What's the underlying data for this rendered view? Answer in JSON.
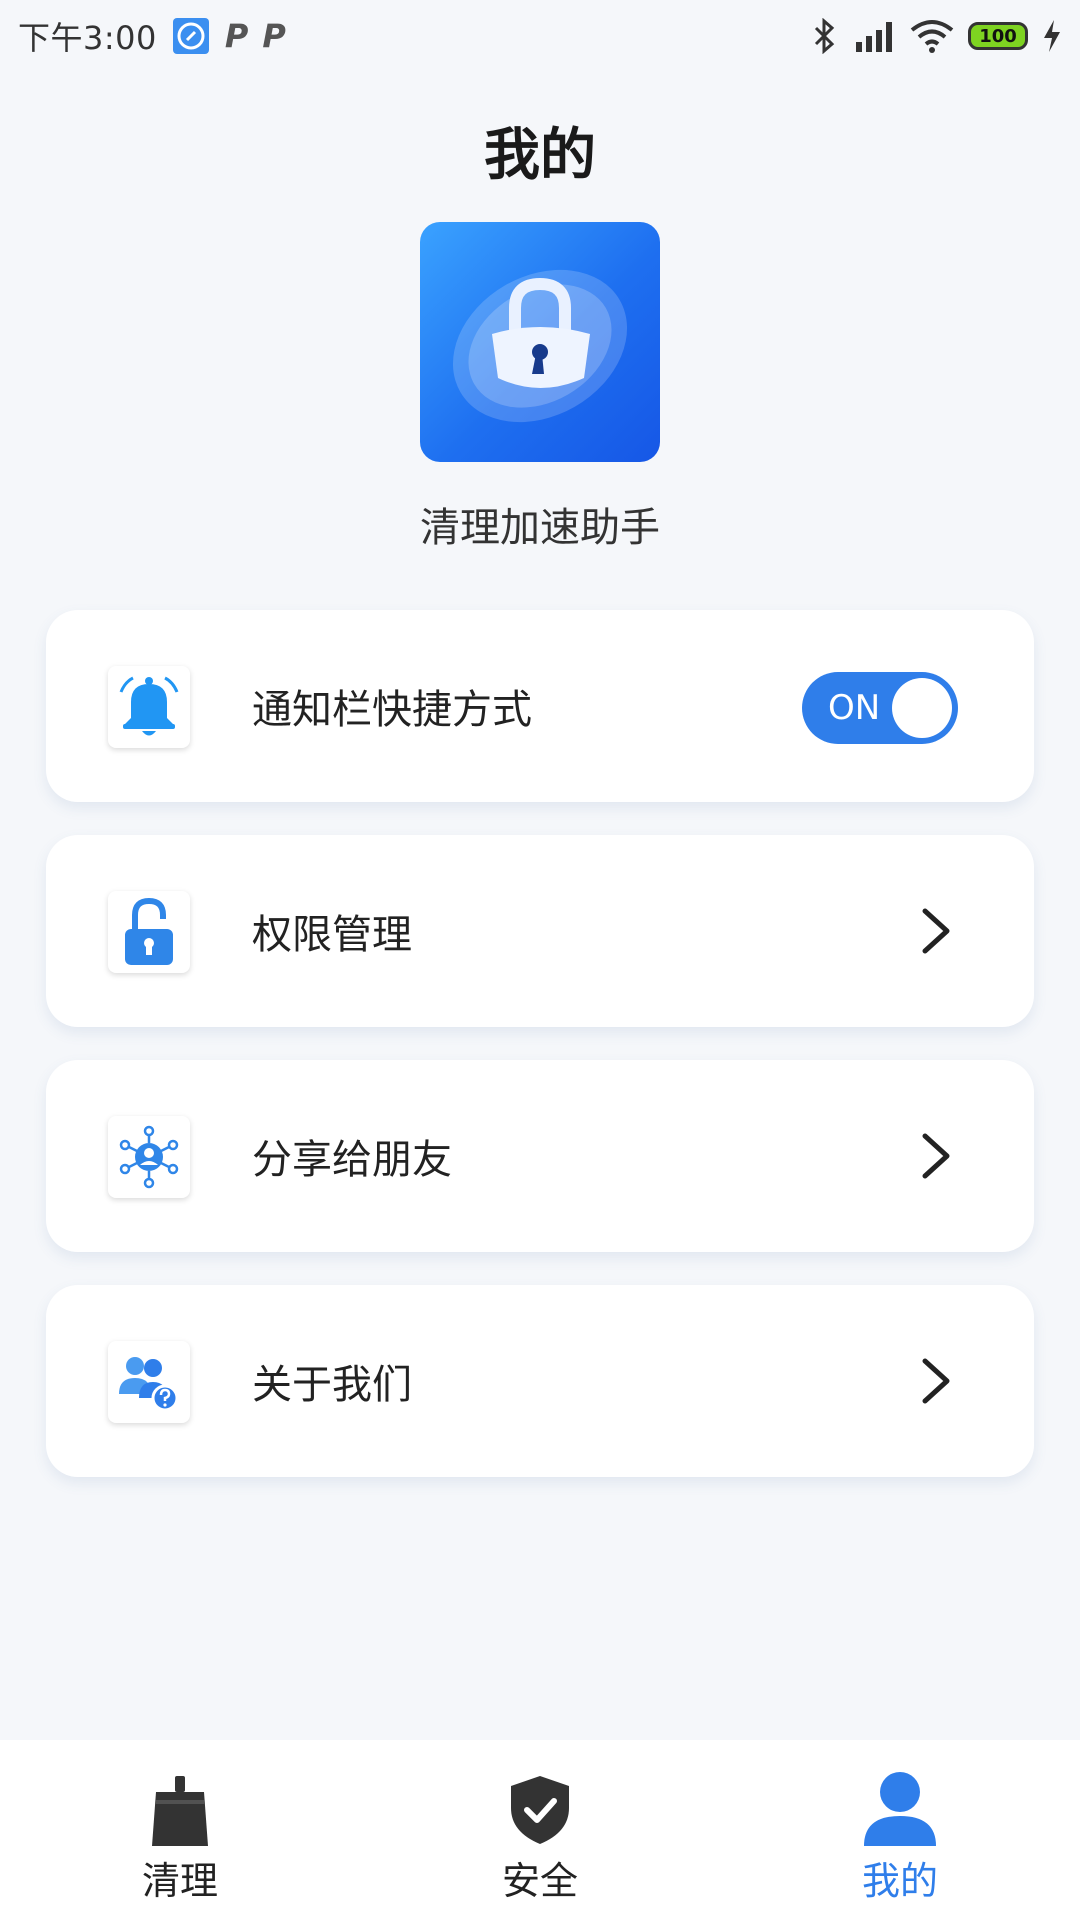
{
  "status_bar": {
    "time": "下午3:00",
    "p1": "P",
    "p2": "P",
    "battery": "100"
  },
  "page": {
    "title": "我的",
    "app_name": "清理加速助手"
  },
  "menu": {
    "items": [
      {
        "label": "通知栏快捷方式",
        "icon": "bell-icon",
        "toggle": "ON"
      },
      {
        "label": "权限管理",
        "icon": "unlock-icon"
      },
      {
        "label": "分享给朋友",
        "icon": "share-network-icon"
      },
      {
        "label": "关于我们",
        "icon": "users-help-icon"
      }
    ]
  },
  "nav": {
    "items": [
      {
        "label": "清理",
        "icon": "broom-icon"
      },
      {
        "label": "安全",
        "icon": "shield-check-icon"
      },
      {
        "label": "我的",
        "icon": "user-icon",
        "active": true
      }
    ]
  },
  "colors": {
    "accent": "#2f7eea",
    "background": "#f5f7fa",
    "battery": "#7ed321"
  }
}
